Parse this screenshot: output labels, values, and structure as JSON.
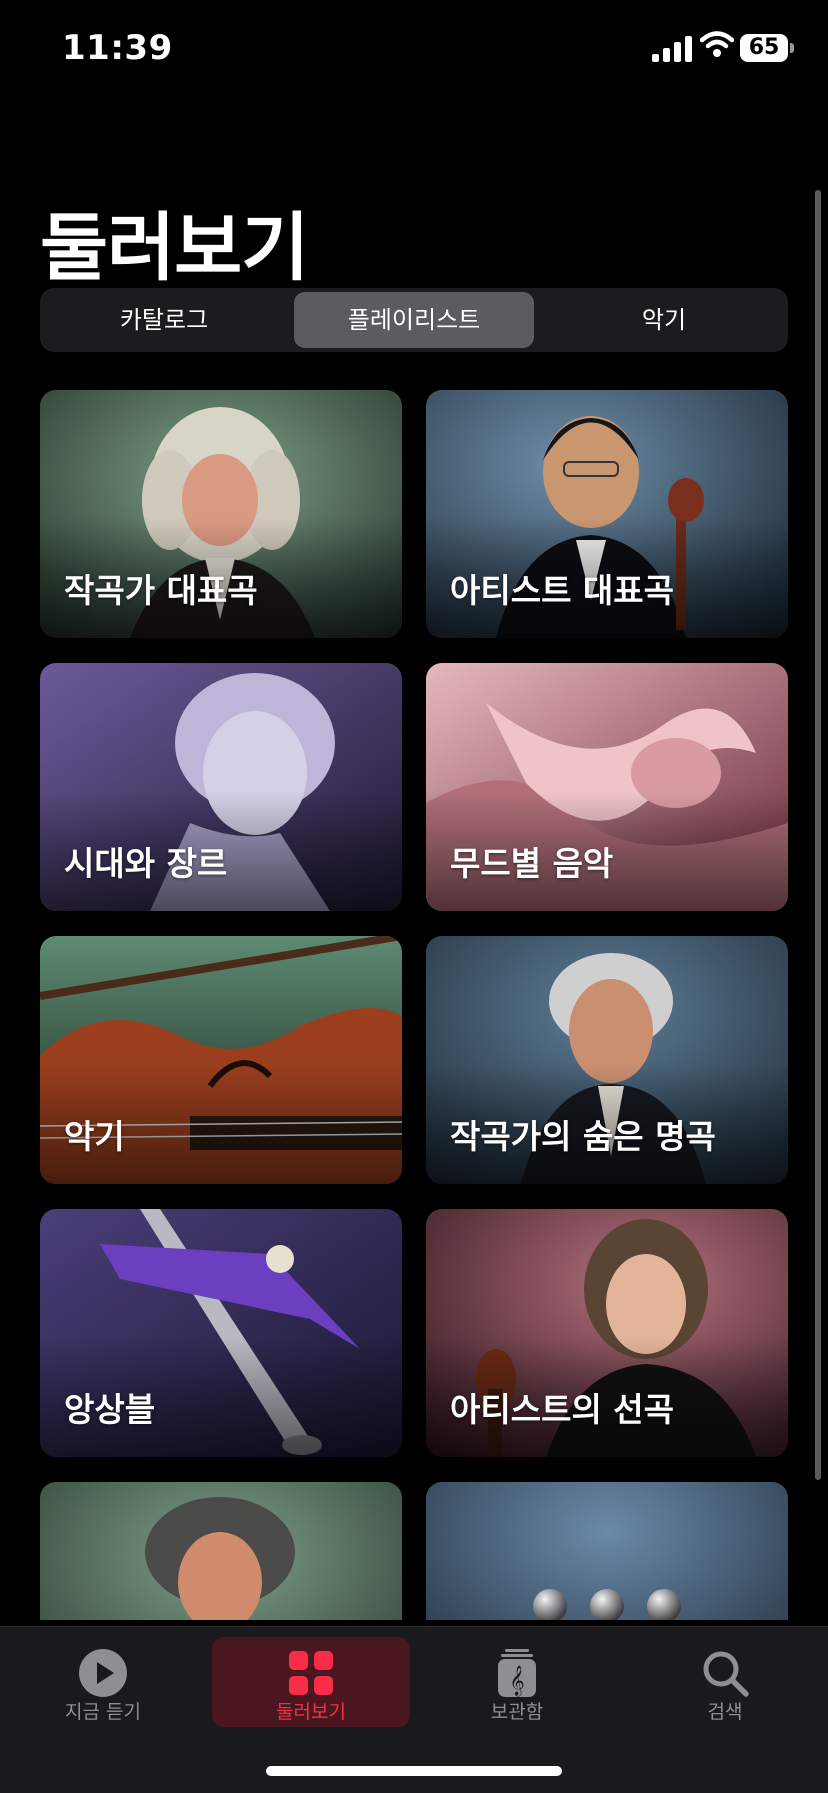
{
  "status_bar": {
    "time": "11:39",
    "battery": "65"
  },
  "page": {
    "title": "둘러보기"
  },
  "segments": [
    {
      "label": "카탈로그",
      "active": false
    },
    {
      "label": "플레이리스트",
      "active": true
    },
    {
      "label": "악기",
      "active": false
    }
  ],
  "cards": [
    {
      "label": "작곡가 대표곡",
      "image": "baroque-composer-portrait"
    },
    {
      "label": "아티스트 대표곡",
      "image": "cellist-portrait"
    },
    {
      "label": "시대와 장르",
      "image": "classical-bust-sculpture"
    },
    {
      "label": "무드별 음악",
      "image": "pink-fabric-swirl"
    },
    {
      "label": "악기",
      "image": "violin-closeup"
    },
    {
      "label": "작곡가의 숨은 명곡",
      "image": "classical-composer-portrait"
    },
    {
      "label": "앙상블",
      "image": "abstract-pipe-shapes"
    },
    {
      "label": "아티스트의 선곡",
      "image": "violinist-portrait"
    },
    {
      "label": "",
      "image": "beethoven-portrait"
    },
    {
      "label": "",
      "image": "metal-spheres"
    }
  ],
  "tabbar": {
    "items": [
      {
        "label": "지금 듣기",
        "icon": "play-circle-icon",
        "active": false
      },
      {
        "label": "둘러보기",
        "icon": "grid-icon",
        "active": true
      },
      {
        "label": "보관함",
        "icon": "library-icon",
        "active": false
      },
      {
        "label": "검색",
        "icon": "search-icon",
        "active": false
      }
    ]
  },
  "colors": {
    "accent": "#fa2d48",
    "background": "#000000",
    "segment_bg": "#1c1c1e",
    "segment_active": "#5b5b60"
  }
}
